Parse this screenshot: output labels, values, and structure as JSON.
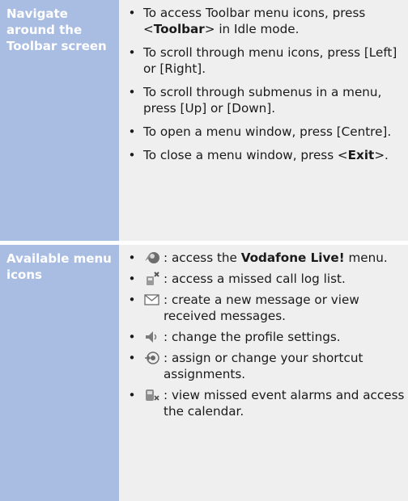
{
  "navigate": {
    "heading": "Navigate around the Toolbar screen",
    "items": [
      {
        "before": "To access Toolbar menu icons, press <",
        "bold": "Toolbar",
        "after": "> in Idle mode."
      },
      {
        "before": "To scroll through menu icons, press [Left] or [Right].",
        "bold": "",
        "after": ""
      },
      {
        "before": "To scroll through submenus in a menu, press [Up] or [Down].",
        "bold": "",
        "after": ""
      },
      {
        "before": "To open a menu window, press [Centre].",
        "bold": "",
        "after": ""
      },
      {
        "before": "To close a menu window, press <",
        "bold": "Exit",
        "after": ">."
      }
    ]
  },
  "menu": {
    "heading": "Available menu icons",
    "items": [
      {
        "icon": "vodafone-live-icon",
        "before": ": access the ",
        "bold": "Vodafone Live!",
        "after": " menu."
      },
      {
        "icon": "missed-call-icon",
        "before": ": access a missed call log list.",
        "bold": "",
        "after": ""
      },
      {
        "icon": "envelope-icon",
        "before": ": create a new message or view received messages.",
        "bold": "",
        "after": ""
      },
      {
        "icon": "speaker-icon",
        "before": ": change the profile settings.",
        "bold": "",
        "after": ""
      },
      {
        "icon": "shortcut-icon",
        "before": ": assign or change your shortcut assignments.",
        "bold": "",
        "after": ""
      },
      {
        "icon": "event-alarm-icon",
        "before": ": view missed event alarms and access the calendar.",
        "bold": "",
        "after": ""
      }
    ]
  },
  "bullet": "•"
}
